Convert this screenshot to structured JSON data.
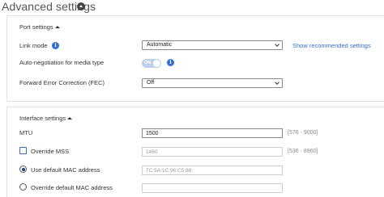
{
  "header": {
    "title": "Advanced settings"
  },
  "port_settings": {
    "title": "Port settings",
    "link_mode": {
      "label": "Link mode",
      "value": "Automatic",
      "link": "Show recommended settings"
    },
    "auto_negotiation": {
      "label": "Auto-negotiation for media type",
      "toggle_text": "ON",
      "state": "on"
    },
    "fec": {
      "label": "Forward Error Correction (FEC)",
      "value": "Off"
    }
  },
  "interface_settings": {
    "title": "Interface settings",
    "mtu": {
      "label": "MTU",
      "value": "1500",
      "range": "[576 - 9000]"
    },
    "override_mss": {
      "label": "Override MSS",
      "value": "1460",
      "range": "[536 - 8960]",
      "checked": false
    },
    "use_default_mac": {
      "label": "Use default MAC address",
      "value": "7C:5A:1C:96:C5:88",
      "selected": true
    },
    "override_default_mac": {
      "label": "Override default MAC address",
      "value": "",
      "selected": false
    }
  },
  "colors": {
    "accent": "#2f6fd6",
    "toggle": "#bfcfe8"
  }
}
